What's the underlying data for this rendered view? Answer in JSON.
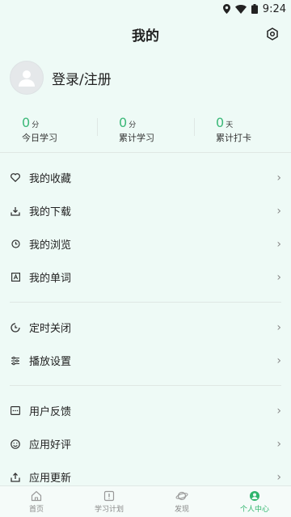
{
  "status": {
    "time": "9:24"
  },
  "header": {
    "title": "我的"
  },
  "profile": {
    "login_label": "登录/注册"
  },
  "stats": [
    {
      "value": "0",
      "unit": "分",
      "label": "今日学习"
    },
    {
      "value": "0",
      "unit": "分",
      "label": "累计学习"
    },
    {
      "value": "0",
      "unit": "天",
      "label": "累计打卡"
    }
  ],
  "menu": {
    "group1": [
      {
        "label": "我的收藏",
        "icon": "heart-icon"
      },
      {
        "label": "我的下载",
        "icon": "download-icon"
      },
      {
        "label": "我的浏览",
        "icon": "clock-icon"
      },
      {
        "label": "我的单词",
        "icon": "word-icon"
      }
    ],
    "group2": [
      {
        "label": "定时关闭",
        "icon": "timer-icon"
      },
      {
        "label": "播放设置",
        "icon": "sliders-icon"
      }
    ],
    "group3": [
      {
        "label": "用户反馈",
        "icon": "feedback-icon"
      },
      {
        "label": "应用好评",
        "icon": "smile-icon"
      },
      {
        "label": "应用更新",
        "icon": "upload-icon"
      }
    ]
  },
  "tabs": [
    {
      "label": "首页",
      "icon": "home-icon"
    },
    {
      "label": "学习计划",
      "icon": "plan-icon"
    },
    {
      "label": "发现",
      "icon": "planet-icon"
    },
    {
      "label": "个人中心",
      "icon": "user-icon"
    }
  ],
  "colors": {
    "accent": "#2fb56c",
    "background": "#eefaf6"
  }
}
